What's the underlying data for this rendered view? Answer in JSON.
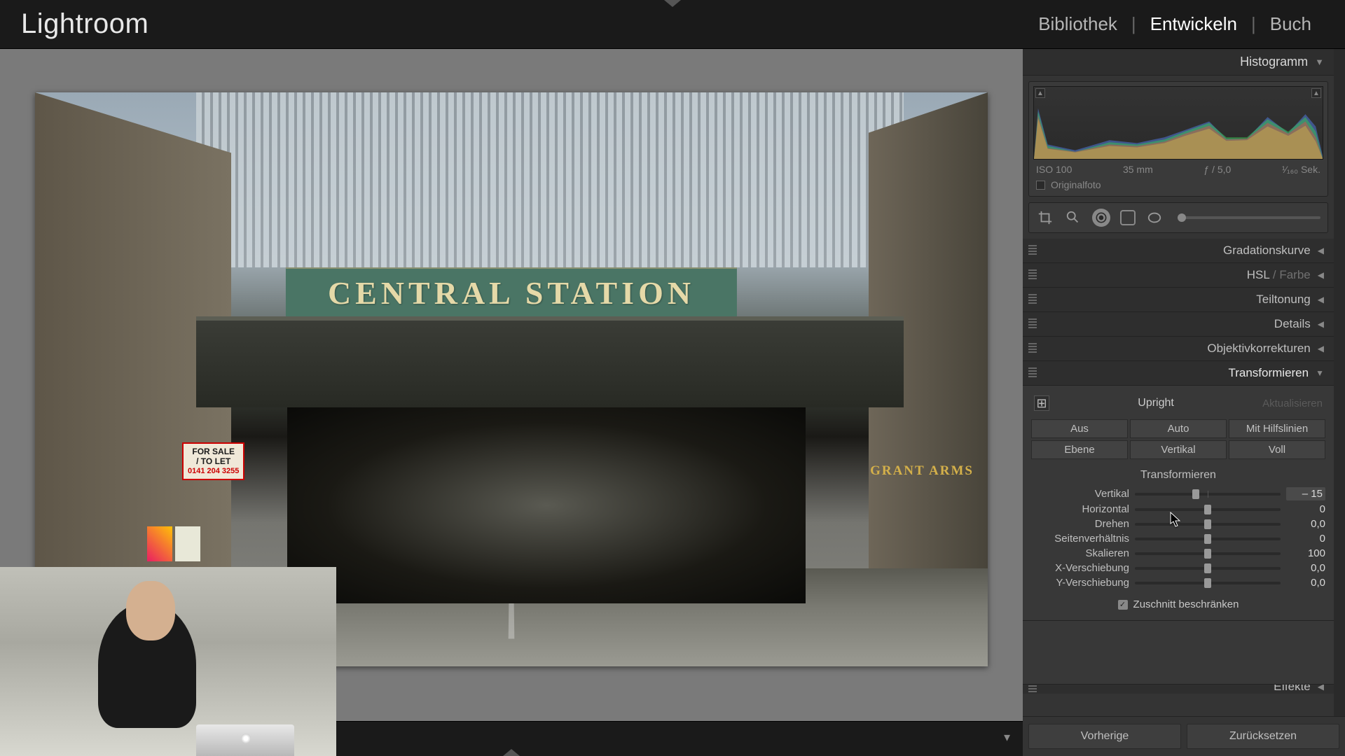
{
  "app": {
    "title": "Lightroom"
  },
  "modules": {
    "library": "Bibliothek",
    "develop": "Entwickeln",
    "book": "Buch",
    "active": "develop"
  },
  "histogram": {
    "title": "Histogramm",
    "iso": "ISO 100",
    "focal": "35 mm",
    "aperture": "ƒ / 5,0",
    "shutter": "¹⁄₁₆₀ Sek.",
    "original_label": "Originalfoto"
  },
  "collapsed_panels": [
    {
      "label": "Gradationskurve"
    },
    {
      "label_a": "HSL",
      "label_b": " / Farbe"
    },
    {
      "label": "Teiltonung"
    },
    {
      "label": "Details"
    },
    {
      "label": "Objektivkorrekturen"
    }
  ],
  "transform": {
    "title": "Transformieren",
    "upright_label": "Upright",
    "update_label": "Aktualisieren",
    "buttons": {
      "off": "Aus",
      "auto": "Auto",
      "guided": "Mit Hilfslinien",
      "level": "Ebene",
      "vertical": "Vertikal",
      "full": "Voll"
    },
    "section_title": "Transformieren",
    "sliders": [
      {
        "label": "Vertikal",
        "value": "– 15",
        "pos": 42,
        "active": true
      },
      {
        "label": "Horizontal",
        "value": "0",
        "pos": 50
      },
      {
        "label": "Drehen",
        "value": "0,0",
        "pos": 50
      },
      {
        "label": "Seitenverhältnis",
        "value": "0",
        "pos": 50
      },
      {
        "label": "Skalieren",
        "value": "100",
        "pos": 50
      },
      {
        "label": "X-Verschiebung",
        "value": "0,0",
        "pos": 50
      },
      {
        "label": "Y-Verschiebung",
        "value": "0,0",
        "pos": 50
      }
    ],
    "constrain_label": "Zuschnitt beschränken"
  },
  "effects_peek": "Effekte",
  "bottom": {
    "previous": "Vorherige",
    "reset": "Zurücksetzen"
  },
  "photo": {
    "sign": "CENTRAL STATION",
    "pub": "GRANT ARMS",
    "sale_a": "FOR SALE",
    "sale_b": "/ TO LET",
    "sale_tel": "0141 204 3255"
  }
}
